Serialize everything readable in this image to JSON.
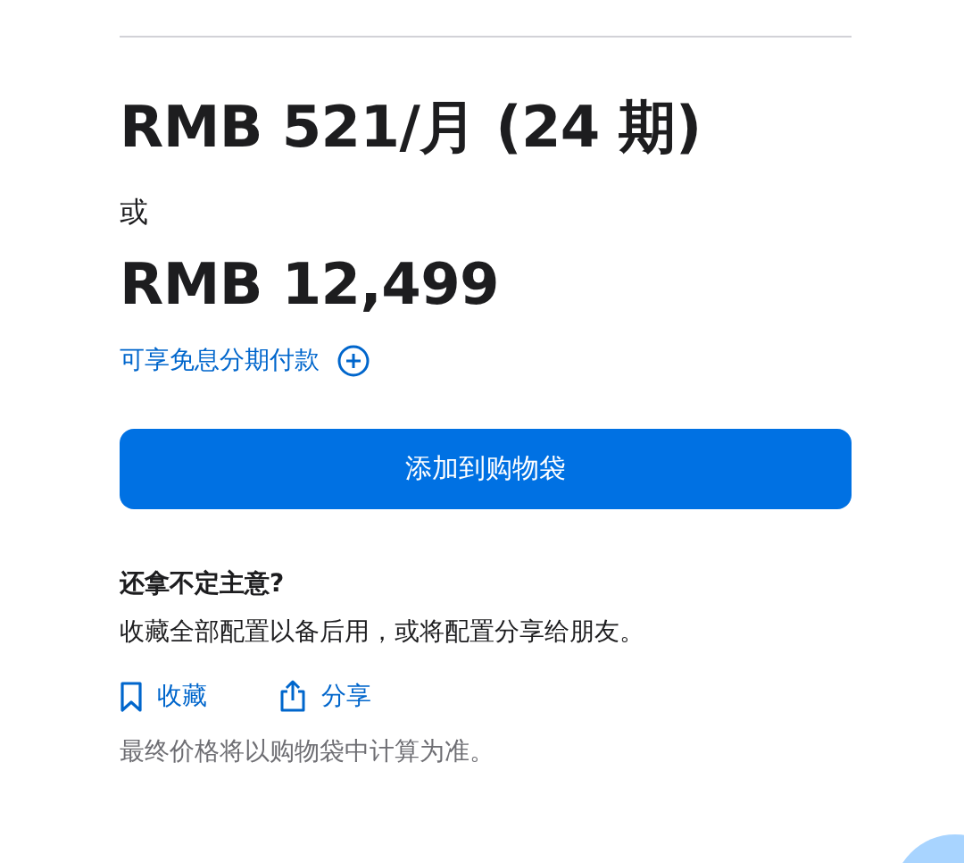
{
  "monthly_price": "RMB 521/月 (24 期)",
  "or_label": "或",
  "total_price": "RMB 12,499",
  "installment_link": "可享免息分期付款",
  "add_to_bag_button": "添加到购物袋",
  "undecided": {
    "title": "还拿不定主意?",
    "description": "收藏全部配置以备后用，或将配置分享给朋友。"
  },
  "actions": [
    {
      "kind": "save",
      "label": "收藏"
    },
    {
      "kind": "share",
      "label": "分享"
    }
  ],
  "note": "最终价格将以购物袋中计算为准。"
}
